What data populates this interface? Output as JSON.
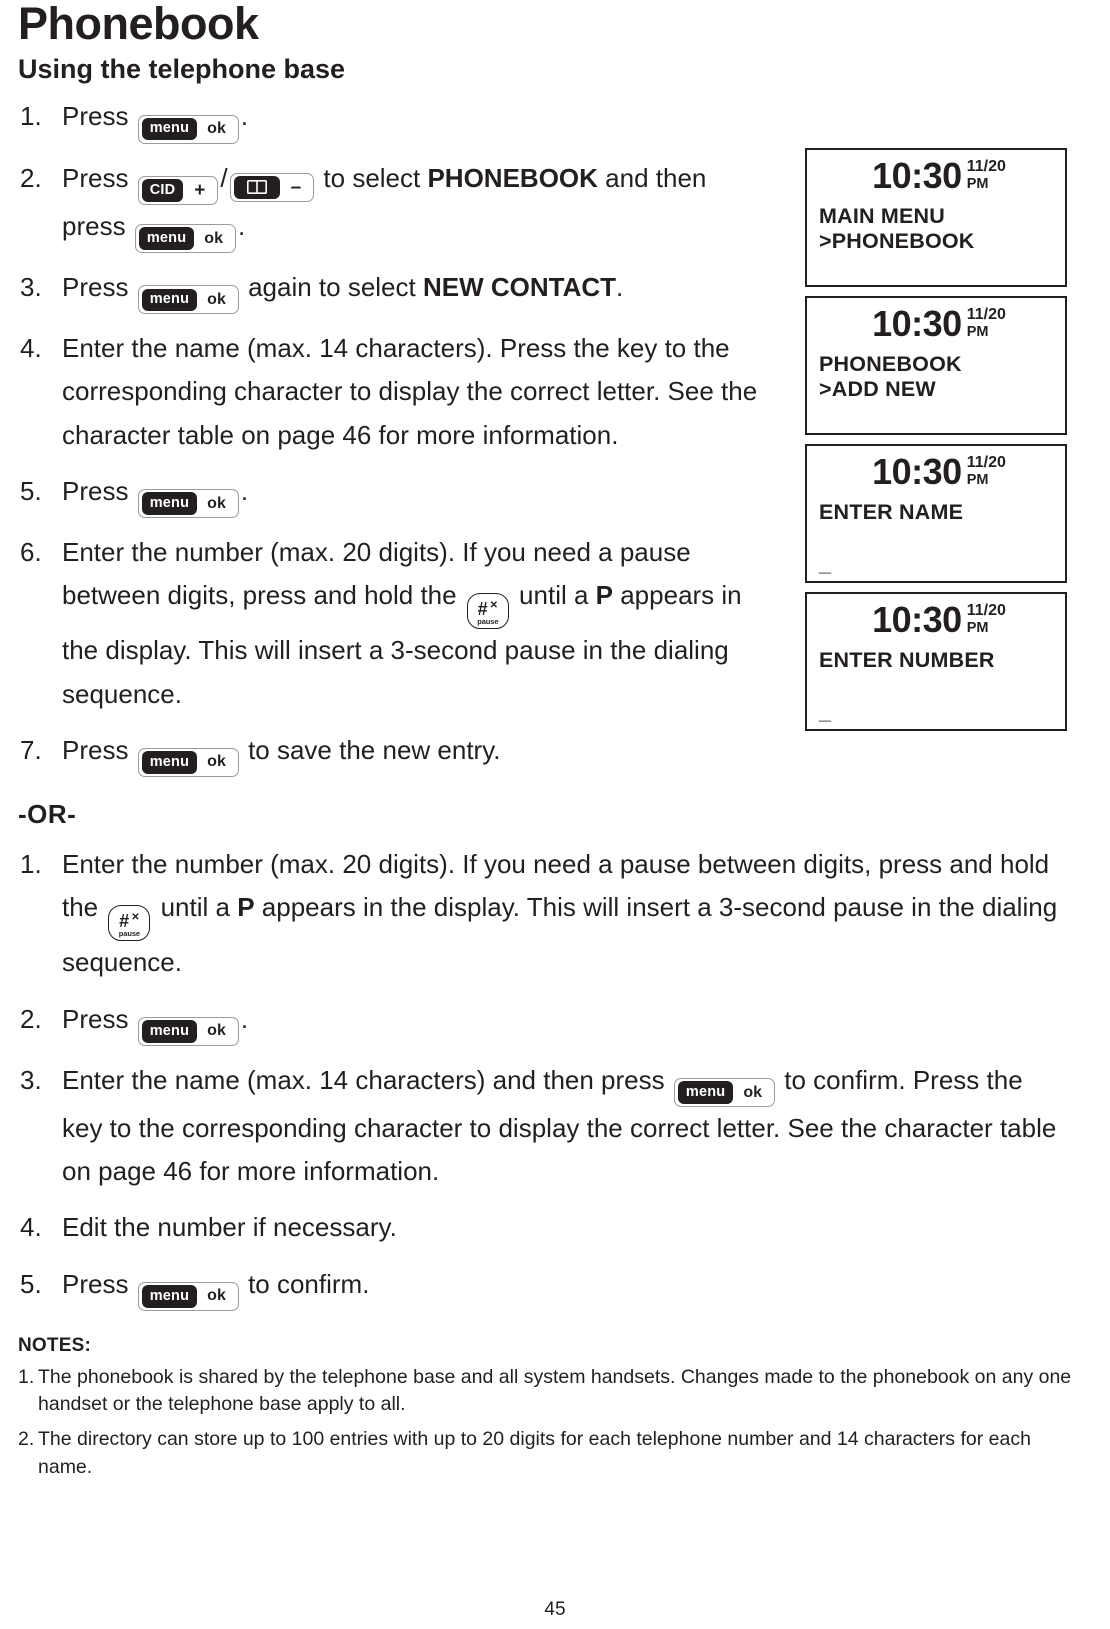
{
  "doc": {
    "title": "Phonebook",
    "subtitle": "Using the telephone base",
    "or_divider": "-OR-",
    "notes_label": "NOTES:",
    "page_number": "45"
  },
  "keys": {
    "menu_ok": {
      "pill": "menu",
      "label": "ok",
      "name": "menu-ok-key"
    },
    "cid_plus": {
      "pill": "CID",
      "label": "+",
      "name": "cid-up-key"
    },
    "book_minus": {
      "pill": "book-icon",
      "label": "–",
      "name": "phonebook-down-key"
    },
    "pause": {
      "hash": "#",
      "star": "✕",
      "word": "pause",
      "name": "hash-pause-key"
    }
  },
  "steps_base": [
    {
      "num": "1.",
      "pre": "Press ",
      "post": "."
    },
    {
      "num": "2.",
      "pre": "Press ",
      "mid": " to select ",
      "bold": "PHONEBOOK",
      "mid2": " and then press ",
      "post": "."
    },
    {
      "num": "3.",
      "pre": "Press ",
      "mid": " again to select ",
      "bold": "NEW CONTACT",
      "post": "."
    },
    {
      "num": "4.",
      "text": "Enter the name (max. 14 characters). Press the key to the corresponding character to display the correct letter. See the character table on page 46 for more information."
    },
    {
      "num": "5.",
      "pre": "Press ",
      "post": "."
    },
    {
      "num": "6.",
      "pre": "Enter the number (max. 20 digits). If you need a pause between digits, press and hold the ",
      "mid": " until a ",
      "bold": "P",
      "post": " appears in the display. This will insert a 3-second pause in the dialing sequence."
    },
    {
      "num": "7.",
      "pre": "Press ",
      "post": " to save the new entry."
    }
  ],
  "steps_or": [
    {
      "num": "1.",
      "pre": "Enter the number (max. 20 digits). If you need a pause between digits, press and hold the ",
      "mid": " until a ",
      "bold": "P",
      "post": " appears in the display. This will insert a 3-second pause in the dialing sequence."
    },
    {
      "num": "2.",
      "pre": "Press ",
      "post": "."
    },
    {
      "num": "3.",
      "pre": "Enter the name (max. 14 characters) and then press ",
      "post": " to confirm. Press the key to the corresponding character to display the correct letter. See the character table on page 46 for more information."
    },
    {
      "num": "4.",
      "text": "Edit the number if necessary."
    },
    {
      "num": "5.",
      "pre": "Press ",
      "post": " to confirm."
    }
  ],
  "notes": [
    {
      "num": "1.",
      "text": "The phonebook is shared by the telephone base and all system handsets. Changes made to the phonebook on any one handset or the telephone base apply to all."
    },
    {
      "num": "2.",
      "text": "The directory can store up to 100 entries with up to 20 digits for each telephone number and 14 characters for each name."
    }
  ],
  "lcd_screens": [
    {
      "clock": "10:30",
      "date": "11/20",
      "ampm": "PM",
      "line1": "MAIN MENU",
      "line2": ">PHONEBOOK",
      "cursor": ""
    },
    {
      "clock": "10:30",
      "date": "11/20",
      "ampm": "PM",
      "line1": "PHONEBOOK",
      "line2": ">ADD NEW",
      "cursor": ""
    },
    {
      "clock": "10:30",
      "date": "11/20",
      "ampm": "PM",
      "line1": "ENTER NAME",
      "line2": "",
      "cursor": "_"
    },
    {
      "clock": "10:30",
      "date": "11/20",
      "ampm": "PM",
      "line1": "ENTER NUMBER",
      "line2": "",
      "cursor": "_"
    }
  ]
}
